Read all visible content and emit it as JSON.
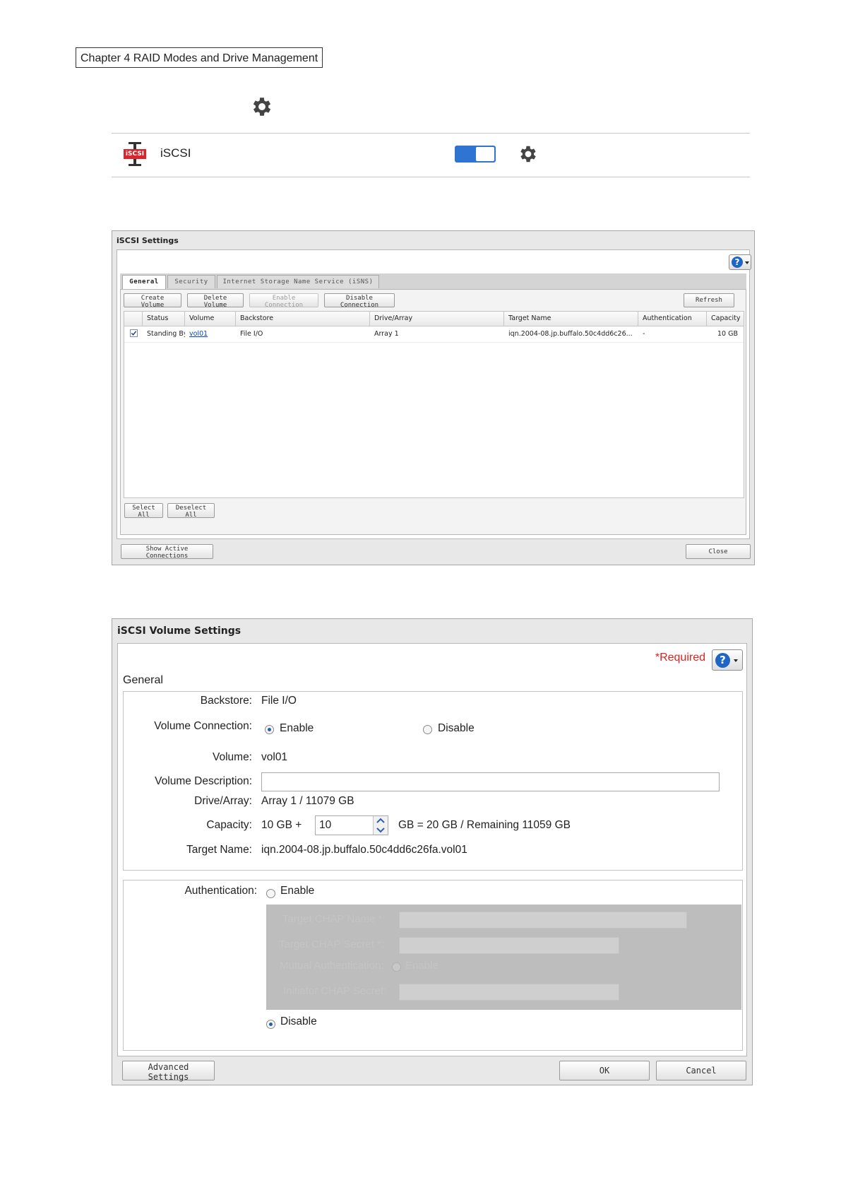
{
  "header": {
    "chapter": "Chapter 4 RAID Modes and Drive Management"
  },
  "service_row": {
    "label": "iSCSI",
    "icon_text": "iSCSI",
    "enabled": true
  },
  "iscsi_settings": {
    "title": "iSCSI Settings",
    "tabs": [
      "General",
      "Security",
      "Internet Storage Name Service (iSNS)"
    ],
    "toolbar": {
      "create": "Create Volume",
      "delete": "Delete Volume",
      "enable": "Enable Connection",
      "disable": "Disable Connection",
      "refresh": "Refresh"
    },
    "columns": [
      "Status",
      "Volume",
      "Backstore",
      "Drive/Array",
      "Target Name",
      "Authentication",
      "Capacity"
    ],
    "rows": [
      {
        "checked": true,
        "status": "Standing By",
        "volume": "vol01",
        "backstore": "File I/O",
        "drive": "Array 1",
        "target": "iqn.2004-08.jp.buffalo.50c4dd6c26...",
        "auth": "-",
        "capacity": "10 GB"
      }
    ],
    "select_all": "Select All",
    "deselect_all": "Deselect All",
    "show_active": "Show Active Connections",
    "close": "Close"
  },
  "volume_settings": {
    "title": "iSCSI Volume Settings",
    "required": "*Required",
    "section": "General",
    "backstore_label": "Backstore:",
    "backstore_value": "File I/O",
    "connection_label": "Volume Connection:",
    "enable": "Enable",
    "disable": "Disable",
    "volume_label": "Volume:",
    "volume_value": "vol01",
    "description_label": "Volume Description:",
    "description_value": "",
    "drive_label": "Drive/Array:",
    "drive_value": "Array 1 / 11079 GB",
    "capacity_label": "Capacity:",
    "capacity_prefix": "10 GB +",
    "capacity_input": "10",
    "capacity_suffix": "GB = 20 GB / Remaining 11059 GB",
    "target_label": "Target Name:",
    "target_value": "iqn.2004-08.jp.buffalo.50c4dd6c26fa.vol01",
    "auth_label": "Authentication:",
    "auth_enable": "Enable",
    "auth_disable": "Disable",
    "chap_name": "Target CHAP Name *:",
    "chap_secret": "Target CHAP Secret *:",
    "mutual": "Mutual Authentication:",
    "mutual_enable": "Enable",
    "initiator_secret": "Initiator CHAP Secret:",
    "advanced": "Advanced Settings",
    "ok": "OK",
    "cancel": "Cancel"
  }
}
